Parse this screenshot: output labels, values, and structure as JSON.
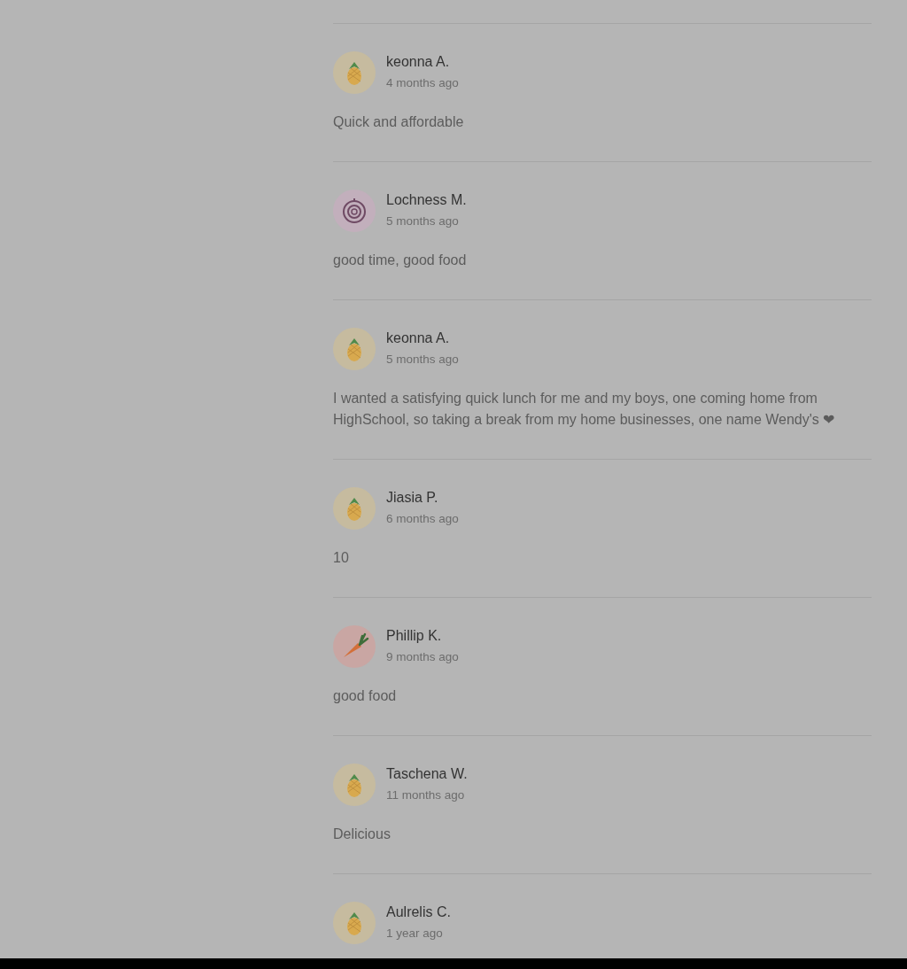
{
  "reviews": [
    {
      "name": "keonna A.",
      "time": "4 months ago",
      "text": "Quick and affordable",
      "avatar": {
        "kind": "pineapple"
      }
    },
    {
      "name": "Lochness M.",
      "time": "5 months ago",
      "text": "good time, good food",
      "avatar": {
        "kind": "onion"
      }
    },
    {
      "name": "keonna A.",
      "time": "5 months ago",
      "text": "I wanted a satisfying quick lunch for me and my boys, one coming home from HighSchool, so taking a break from my home businesses, one name Wendy's ❤",
      "avatar": {
        "kind": "pineapple"
      }
    },
    {
      "name": "Jiasia P.",
      "time": "6 months ago",
      "text": "10",
      "avatar": {
        "kind": "pineapple"
      }
    },
    {
      "name": "Phillip K.",
      "time": "9 months ago",
      "text": "good food",
      "avatar": {
        "kind": "carrot"
      }
    },
    {
      "name": "Taschena W.",
      "time": "11 months ago",
      "text": "Delicious",
      "avatar": {
        "kind": "pineapple"
      }
    },
    {
      "name": "Aulrelis C.",
      "time": "1 year ago",
      "avatar": {
        "kind": "pineapple"
      }
    }
  ]
}
